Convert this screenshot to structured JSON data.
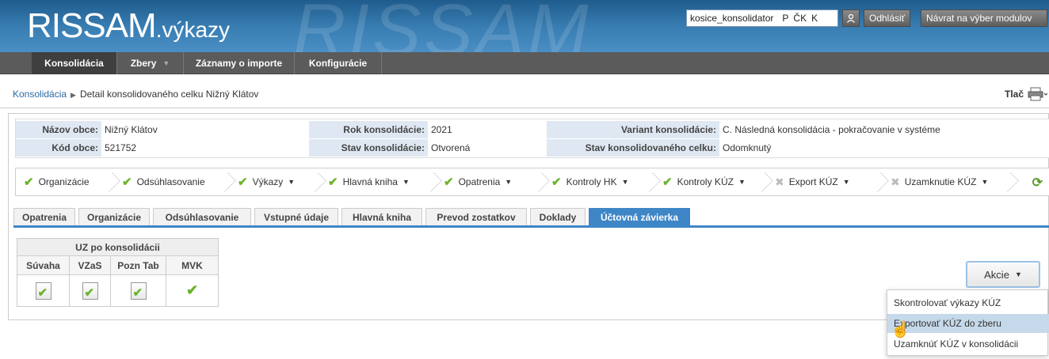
{
  "header": {
    "logo_main": "RISSAM",
    "logo_sub": ".výkazy",
    "watermark": "RISSAM",
    "username": "kosice_konsolidator",
    "lang_p": "P",
    "lang_ck": "ČK",
    "lang_k": "K",
    "logout_label": "Odhlásiť",
    "back_label": "Návrat na výber modulov"
  },
  "nav": {
    "items": [
      {
        "label": "Konsolidácia"
      },
      {
        "label": "Zbery"
      },
      {
        "label": "Záznamy o importe"
      },
      {
        "label": "Konfigurácie"
      }
    ]
  },
  "breadcrumb": {
    "root": "Konsolidácia",
    "current": "Detail konsolidovaného celku Nižný Klátov"
  },
  "print_label": "Tlač",
  "info": {
    "nazov_label": "Názov obce:",
    "nazov_value": "Nižný Klátov",
    "kod_label": "Kód obce:",
    "kod_value": "521752",
    "rok_label": "Rok konsolidácie:",
    "rok_value": "2021",
    "stav_label": "Stav konsolidácie:",
    "stav_value": "Otvorená",
    "variant_label": "Variant konsolidácie:",
    "variant_value": "C. Následná konsolidácia - pokračovanie v systéme",
    "stav_celku_label": "Stav konsolidovaného celku:",
    "stav_celku_value": "Odomknutý"
  },
  "steps": [
    {
      "label": "Organizácie"
    },
    {
      "label": "Odsúhlasovanie"
    },
    {
      "label": "Výkazy"
    },
    {
      "label": "Hlavná kniha"
    },
    {
      "label": "Opatrenia"
    },
    {
      "label": "Kontroly HK"
    },
    {
      "label": "Kontroly KÚZ"
    },
    {
      "label": "Export KÚZ"
    },
    {
      "label": "Uzamknutie KÚZ"
    }
  ],
  "tabs": [
    {
      "label": "Opatrenia"
    },
    {
      "label": "Organizácie"
    },
    {
      "label": "Odsúhlasovanie"
    },
    {
      "label": "Vstupné údaje"
    },
    {
      "label": "Hlavná kniha"
    },
    {
      "label": "Prevod zostatkov"
    },
    {
      "label": "Doklady"
    },
    {
      "label": "Účtovná závierka"
    }
  ],
  "uz_table": {
    "group_header": "UZ po konsolidácii",
    "columns": [
      "Súvaha",
      "VZaS",
      "Pozn Tab",
      "MVK"
    ]
  },
  "akcie": {
    "label": "Akcie",
    "menu": [
      {
        "label": "Skontrolovať výkazy KÚZ"
      },
      {
        "label": "Exportovať KÚZ do zberu"
      },
      {
        "label": "Uzamknúť KÚZ v konsolidácii"
      }
    ]
  }
}
